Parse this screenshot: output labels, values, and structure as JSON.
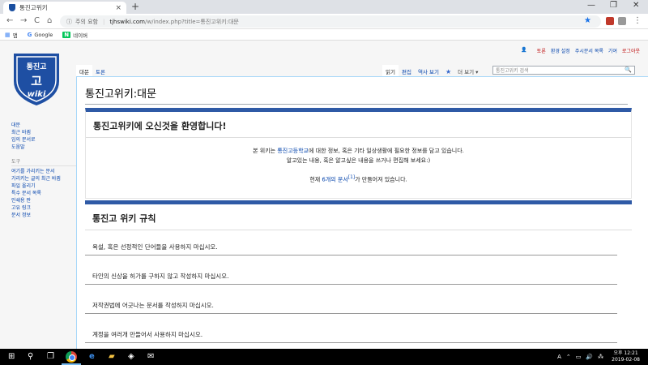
{
  "browser": {
    "tab_title": "통진고위키",
    "tab_close": "×",
    "new_tab": "+",
    "win_min": "—",
    "win_max": "❐",
    "win_close": "✕",
    "back": "←",
    "forward": "→",
    "reload": "C",
    "home": "⌂",
    "info_icon": "ⓘ",
    "security_label": "주의 요함",
    "url_host": "tjhswiki.com",
    "url_path": "/w/index.php?title=통진고위키:대문",
    "menu": "⋮",
    "bookmarks": [
      {
        "icon": "▦",
        "label": "앱"
      },
      {
        "icon": "G",
        "label": "Google"
      },
      {
        "icon": "N",
        "label": "네이버"
      }
    ]
  },
  "wiki": {
    "logo_top": "통진고",
    "logo_mid": "고",
    "logo_bottom": "wiki",
    "personal": {
      "user_icon": "👤",
      "items": [
        "토론",
        "환경 설정",
        "주시문서 목록",
        "기여"
      ],
      "login": "로그아웃"
    },
    "nav": {
      "items": [
        "대문",
        "최근 바뀜",
        "임의 문서로",
        "도움말"
      ],
      "tools_head": "도구",
      "tools": [
        "여기를 가리키는 문서",
        "가리키는 글의 최근 바뀜",
        "파일 올리기",
        "특수 문서 목록",
        "인쇄용 판",
        "고유 링크",
        "문서 정보"
      ]
    },
    "tabs_left": [
      "대문",
      "토론"
    ],
    "tabs_right": [
      "읽기",
      "편집",
      "역사 보기"
    ],
    "more_label": "더 보기 ▾",
    "search_placeholder": "통진고위키 검색",
    "search_icon": "🔍",
    "page_title": "통진고위키:대문",
    "welcome": {
      "heading": "통진고위키에 오신것을 환영합니다!",
      "line1_pre": "본 위키는 ",
      "line1_link": "통진고등학교",
      "line1_post": "에 대한 정보, 혹은 기타 일상생활에 필요한 정보를 담고 있습니다.",
      "line2": "알고있는 내용, 혹은 알고싶은 내용을 쓰거나 편집해 보세요:)",
      "count_pre": "현재 ",
      "count_link": "6개의 문서",
      "count_ref": "[1]",
      "count_post": "가 만들어져 있습니다."
    },
    "rules": {
      "heading": "통진고 위키 규칙",
      "items": [
        "욕설, 혹은 선정적인 단어들을 사용하지 마십시오.",
        "타인의 신상을 허가를 구하지 않고 작성하지 마십시오.",
        "저작권법에 어긋나는 문서를 작성하지 마십시오.",
        "계정을 여러개 만들어서 사용하지 마십시오."
      ]
    }
  },
  "taskbar": {
    "start": "⊞",
    "search": "⚲",
    "taskview": "❐",
    "edge": "e",
    "explorer": "▰",
    "store": "◈",
    "mail": "✉",
    "tray_icons": [
      "A",
      "⌃",
      "▭",
      "🔊",
      "⁂"
    ],
    "time": "오후 12:21",
    "date": "2019-02-08"
  },
  "colors": {
    "accent_blue": "#2f5aa6",
    "link": "#0645ad",
    "logout_red": "#ba0000"
  }
}
